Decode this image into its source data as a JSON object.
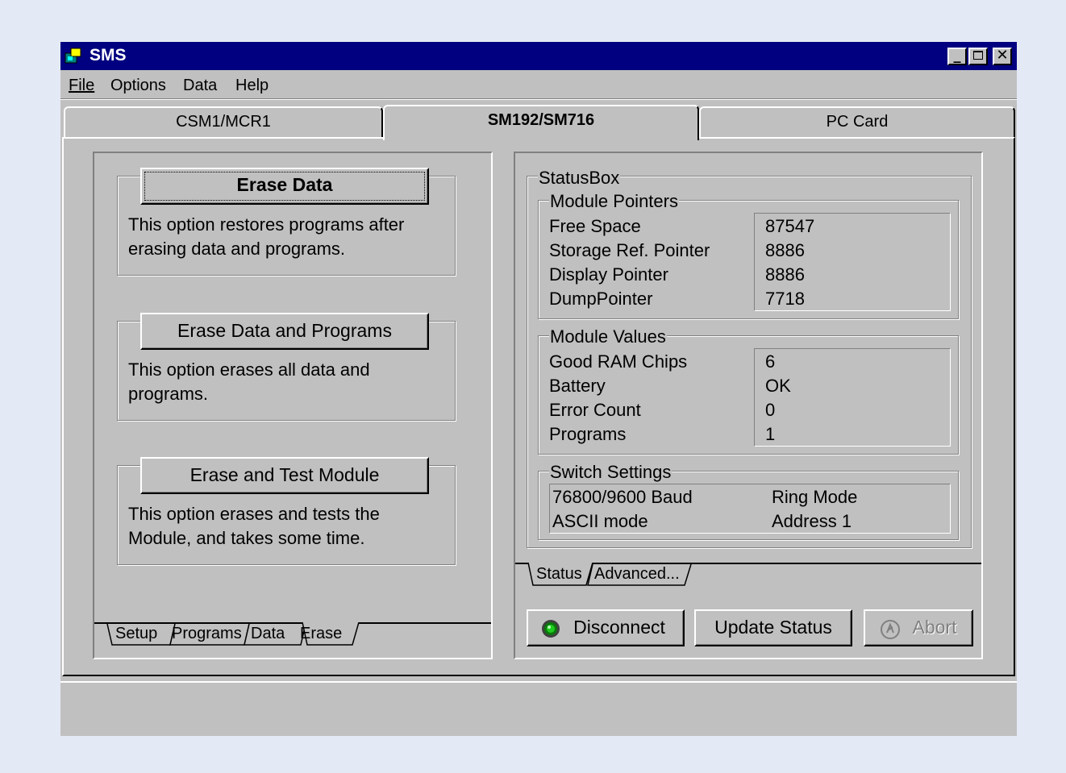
{
  "window": {
    "title": "SMS"
  },
  "menu": {
    "file": "File",
    "options": "Options",
    "data": "Data",
    "help": "Help"
  },
  "top_tabs": [
    {
      "label": "CSM1/MCR1"
    },
    {
      "label": "SM192/SM716"
    },
    {
      "label": "PC Card"
    }
  ],
  "erase": {
    "erase_data": {
      "button": "Erase Data",
      "desc1": "This option restores programs after",
      "desc2": "erasing data and programs."
    },
    "erase_data_programs": {
      "button": "Erase Data and Programs",
      "desc1": "This option erases all data and",
      "desc2": "programs."
    },
    "erase_test": {
      "button": "Erase and Test Module",
      "desc1": "This option erases and tests the",
      "desc2": "Module, and takes some time."
    }
  },
  "left_tabs": [
    "Setup",
    "Programs",
    "Data",
    "Erase"
  ],
  "status_box": {
    "title": "StatusBox",
    "module_pointers": {
      "title": "Module Pointers",
      "rows": [
        {
          "label": "Free Space",
          "value": "87547"
        },
        {
          "label": "Storage Ref. Pointer",
          "value": "8886"
        },
        {
          "label": "Display Pointer",
          "value": "8886"
        },
        {
          "label": "DumpPointer",
          "value": "7718"
        }
      ]
    },
    "module_values": {
      "title": "Module Values",
      "rows": [
        {
          "label": "Good RAM Chips",
          "value": "6"
        },
        {
          "label": "Battery",
          "value": "OK"
        },
        {
          "label": "Error Count",
          "value": "0"
        },
        {
          "label": "Programs",
          "value": "1"
        }
      ]
    },
    "switch_settings": {
      "title": "Switch Settings",
      "baud": "76800/9600 Baud",
      "ring": "Ring Mode",
      "ascii": "ASCII mode",
      "address": "Address 1"
    }
  },
  "right_tabs": [
    "Status",
    "Advanced..."
  ],
  "buttons": {
    "disconnect": "Disconnect",
    "update": "Update Status",
    "abort": "Abort"
  },
  "colors": {
    "title_bar": "#000080",
    "face": "#c0c0c0",
    "led": "#1fcc1f"
  }
}
